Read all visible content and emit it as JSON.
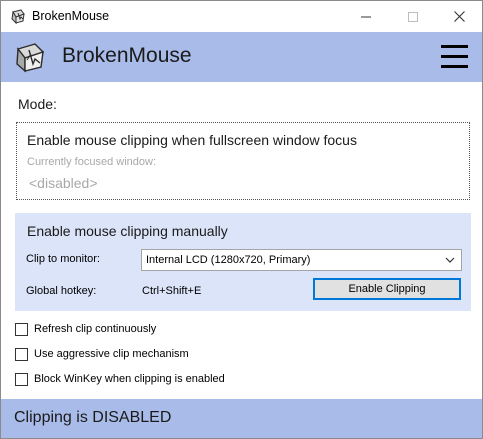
{
  "window": {
    "title": "BrokenMouse"
  },
  "header": {
    "brand": "BrokenMouse",
    "colors": {
      "band": "#a9bce9",
      "panel": "#dbe4f8",
      "accent": "#0078d7"
    }
  },
  "mode": {
    "label": "Mode:"
  },
  "fullscreen": {
    "title": "Enable mouse clipping when fullscreen window focus",
    "focused_label": "Currently focused window:",
    "focused_value": "<disabled>"
  },
  "manual": {
    "title": "Enable mouse clipping manually",
    "clip_label": "Clip to monitor:",
    "monitor_selected": "Internal LCD (1280x720, Primary)",
    "hotkey_label": "Global hotkey:",
    "hotkey_value": "Ctrl+Shift+E",
    "button_label": "Enable Clipping"
  },
  "options": [
    {
      "label": "Refresh clip continuously",
      "checked": false
    },
    {
      "label": "Use aggressive clip mechanism",
      "checked": false
    },
    {
      "label": "Block WinKey when clipping is enabled",
      "checked": false
    }
  ],
  "footer": {
    "status": "Clipping is DISABLED"
  },
  "icons": {
    "app": "broken-mouse-cube-icon",
    "menu": "hamburger-menu-icon",
    "minimize": "minimize-icon",
    "maximize": "maximize-icon",
    "close": "close-icon",
    "dropdown": "chevron-down-icon"
  }
}
